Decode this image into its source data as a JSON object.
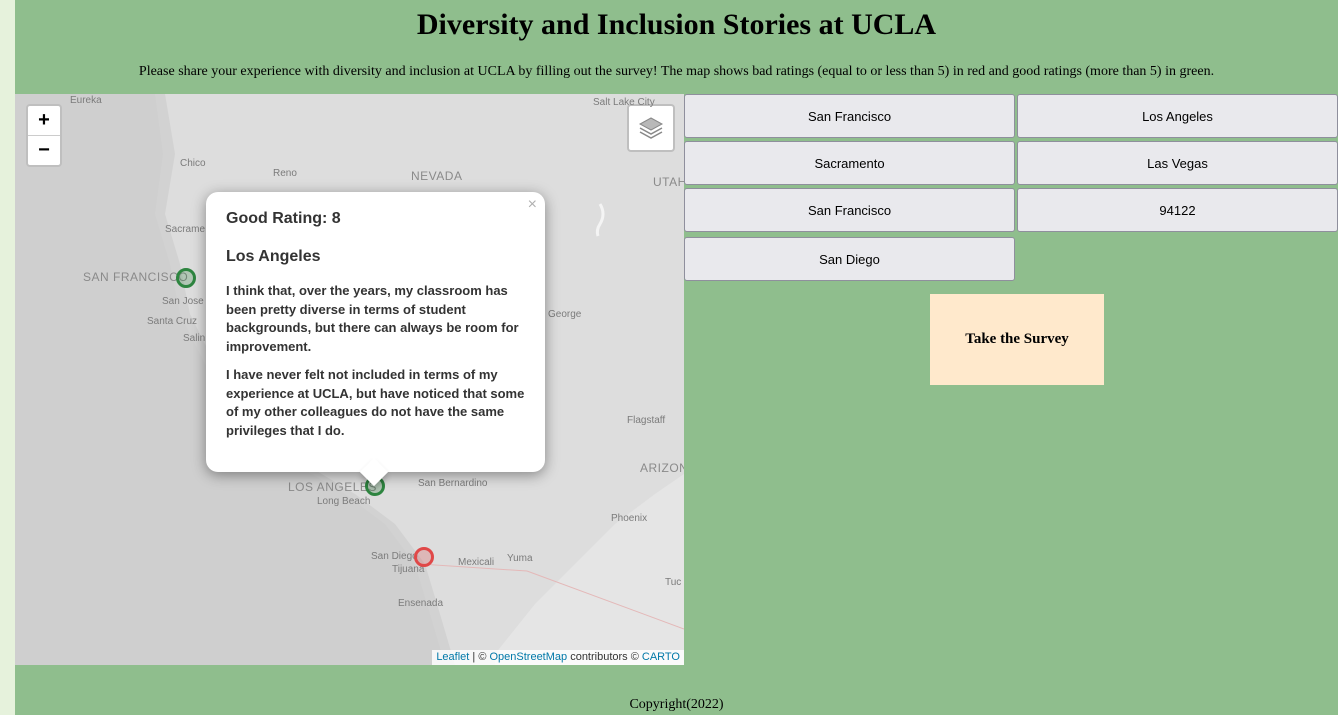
{
  "title": "Diversity and Inclusion Stories at UCLA",
  "intro": "Please share your experience with diversity and inclusion at UCLA by filling out the survey! The map shows bad ratings (equal to or less than 5) in red and good ratings (more than 5) in green.",
  "map": {
    "zoom_in": "+",
    "zoom_out": "−",
    "places": {
      "eureka": "Eureka",
      "salt_lake": "Salt Lake City",
      "chico": "Chico",
      "reno": "Reno",
      "nevada": "NEVADA",
      "utah": "UTAH",
      "sacramento": "Sacrame",
      "san_francisco": "SAN FRANCISCO",
      "san_jose": "San Jose",
      "santa_cruz": "Santa Cruz",
      "salinas": "Salin",
      "st_george": "George",
      "flagstaff": "Flagstaff",
      "arizona": "ARIZON",
      "los_angeles": "LOS ANGELES",
      "san_bernardino": "San Bernardino",
      "long_beach": "Long Beach",
      "phoenix": "Phoenix",
      "san_diego": "San Diego",
      "tijuana": "Tijuana",
      "mexicali": "Mexicali",
      "yuma": "Yuma",
      "tucson": "Tuc",
      "ensenada": "Ensenada"
    },
    "popup": {
      "close": "×",
      "rating": "Good Rating: 8",
      "city": "Los Angeles",
      "paragraph1": "I think that, over the years, my classroom has been pretty diverse in terms of student backgrounds, but there can always be room for improvement.",
      "paragraph2": "I have never felt not included in terms of my experience at UCLA, but have noticed that some of my other colleagues do not have the same privileges that I do."
    },
    "attribution": {
      "leaflet": "Leaflet",
      "sep": " | © ",
      "osm": "OpenStreetMap",
      "contributors": " contributors © ",
      "carto": "CARTO"
    },
    "colors": {
      "good": "#2e8540",
      "bad": "#e04848"
    }
  },
  "city_buttons": [
    "San Francisco",
    "Los Angeles",
    "Sacramento",
    "Las Vegas",
    "San Francisco",
    "94122",
    "San Diego"
  ],
  "survey_button": "Take the Survey",
  "footer": "Copyright(2022)"
}
